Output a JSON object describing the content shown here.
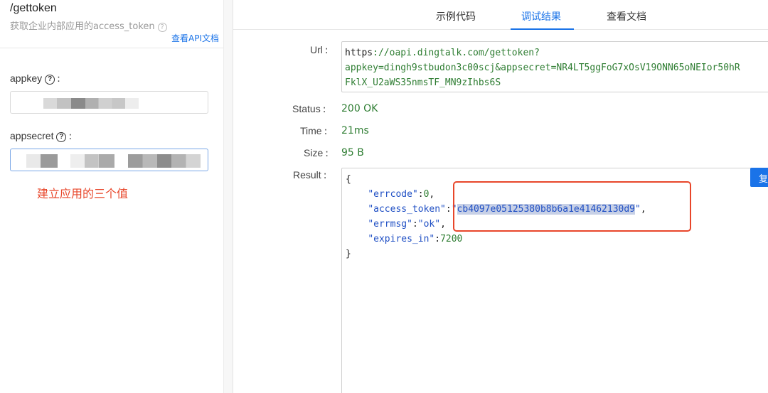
{
  "left": {
    "api_path": "/gettoken",
    "api_desc": "获取企业内部应用的access_token",
    "help_glyph": "?",
    "api_doc_link": "查看API文档",
    "fields": [
      {
        "label": "appkey",
        "help": "?",
        "suffix": ":"
      },
      {
        "label": "appsecret",
        "help": "?",
        "suffix": ":"
      }
    ],
    "annotation": "建立应用的三个值"
  },
  "tabs": [
    {
      "label": "示例代码",
      "active": false
    },
    {
      "label": "调试结果",
      "active": true
    },
    {
      "label": "查看文档",
      "active": false
    }
  ],
  "result_panel": {
    "url_label": "Url",
    "url_line1_scheme": "https",
    "url_line1_rest": "://oapi.dingtalk.com/gettoken?",
    "url_line2": "appkey=dingh9stbudon3c00scj&appsecret=NR4LT5ggFoG7xOsV19ONN65oNEIor50hR",
    "url_line3": "FklX_U2aWS35nmsTF_MN9zIhbs6S",
    "status_label": "Status",
    "status_value": "200 OK",
    "time_label": "Time",
    "time_value": "21ms",
    "size_label": "Size",
    "size_value": "95 B",
    "result_label": "Result",
    "copy_label": "复",
    "colon": ":",
    "json": {
      "open_brace": "{",
      "close_brace": "}",
      "errcode_key": "\"errcode\"",
      "errcode_value": "0",
      "access_token_key": "\"access_token\"",
      "access_token_value": "cb4097e05125380b8b6a1e41462130d9",
      "errmsg_key": "\"errmsg\"",
      "errmsg_value": "\"ok\"",
      "expires_in_key": "\"expires_in\"",
      "expires_in_value": "7200"
    }
  },
  "colors": {
    "accent": "#1a73e8",
    "annotation": "#e8462a",
    "value_green": "#2e7d32",
    "json_blue": "#1f4fc4"
  }
}
